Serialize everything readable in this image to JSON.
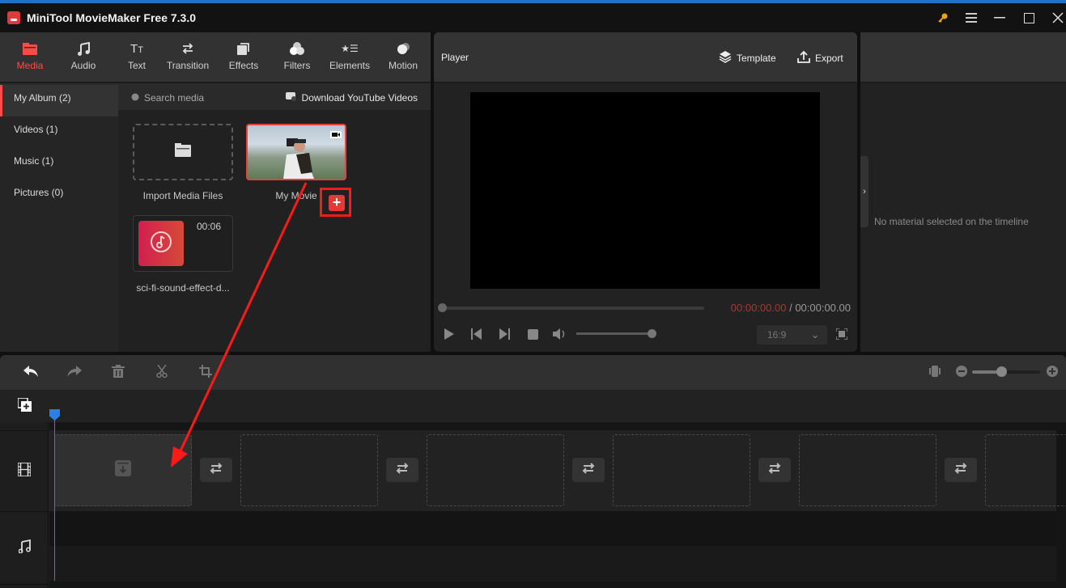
{
  "window": {
    "title": "MiniTool MovieMaker Free 7.3.0",
    "controls": [
      "key-icon",
      "menu-icon",
      "minimize-icon",
      "maximize-icon",
      "close-icon"
    ]
  },
  "toolbar": {
    "tabs": [
      {
        "label": "Media",
        "icon": "folder-icon",
        "active": true
      },
      {
        "label": "Audio",
        "icon": "music-note-icon"
      },
      {
        "label": "Text",
        "icon": "text-icon"
      },
      {
        "label": "Transition",
        "icon": "transition-arrows-icon"
      },
      {
        "label": "Effects",
        "icon": "effects-icon"
      },
      {
        "label": "Filters",
        "icon": "filters-icon"
      },
      {
        "label": "Elements",
        "icon": "elements-icon"
      },
      {
        "label": "Motion",
        "icon": "motion-icon"
      }
    ]
  },
  "album_nav": {
    "items": [
      {
        "label": "My Album (2)",
        "active": true
      },
      {
        "label": "Videos (1)"
      },
      {
        "label": "Music (1)"
      },
      {
        "label": "Pictures (0)"
      }
    ]
  },
  "media": {
    "search_placeholder": "Search media",
    "download_label": "Download YouTube Videos",
    "items": [
      {
        "label": "Import Media Files",
        "type": "import"
      },
      {
        "label": "My Movie",
        "type": "video"
      },
      {
        "label": "sci-fi-sound-effect-d...",
        "type": "audio",
        "duration": "00:06"
      }
    ]
  },
  "player": {
    "title": "Player",
    "template_label": "Template",
    "export_label": "Export",
    "current_time": "00:00:00.00",
    "separator": " / ",
    "total_time": "00:00:00.00",
    "aspect_ratio": "16:9",
    "seek_progress": 0,
    "volume_level": 1.0
  },
  "properties": {
    "empty_message": "No material selected on the timeline"
  },
  "timeline": {
    "tools": [
      "undo",
      "redo",
      "delete",
      "split",
      "crop"
    ],
    "zoom_level": 0.43,
    "video_slots": 6,
    "accent_color": "#2b7fe6"
  },
  "annotation": {
    "color": "#ff1a1a",
    "description": "Red arrow from add-to-timeline button to first timeline slot"
  }
}
